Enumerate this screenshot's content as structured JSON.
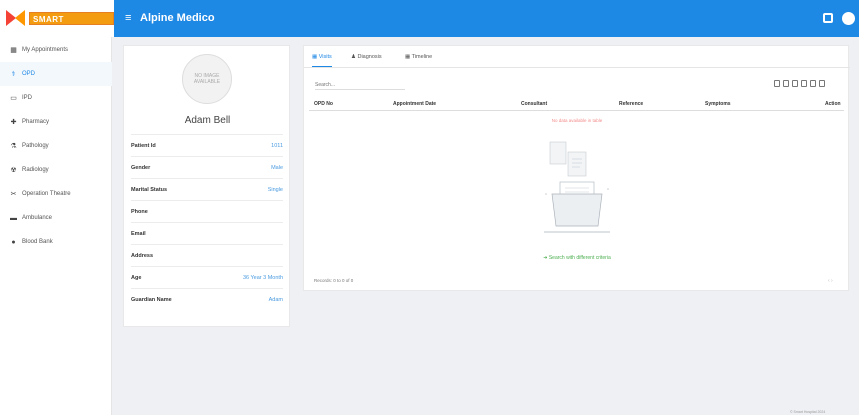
{
  "header": {
    "logo_text": "SMART HOSPITAL",
    "hospital_name": "Alpine Medico",
    "accent": "#1e88e5"
  },
  "sidebar": {
    "items": [
      {
        "label": "My Appointments",
        "icon": "building-icon",
        "glyph": "▦"
      },
      {
        "label": "OPD",
        "icon": "stethoscope-icon",
        "glyph": "⚕"
      },
      {
        "label": "IPD",
        "icon": "bed-icon",
        "glyph": "▭"
      },
      {
        "label": "Pharmacy",
        "icon": "mortar-icon",
        "glyph": "✚"
      },
      {
        "label": "Pathology",
        "icon": "flask-icon",
        "glyph": "⚗"
      },
      {
        "label": "Radiology",
        "icon": "microscope-icon",
        "glyph": "☢"
      },
      {
        "label": "Operation Theatre",
        "icon": "scissors-icon",
        "glyph": "✂"
      },
      {
        "label": "Ambulance",
        "icon": "ambulance-icon",
        "glyph": "🚑"
      },
      {
        "label": "Blood Bank",
        "icon": "blood-drop-icon",
        "glyph": "●"
      }
    ],
    "active_index": 1
  },
  "profile": {
    "avatar_label": "NO IMAGE AVAILABLE",
    "name": "Adam Bell",
    "fields": [
      {
        "label": "Patient Id",
        "value": "1011"
      },
      {
        "label": "Gender",
        "value": "Male"
      },
      {
        "label": "Marital Status",
        "value": "Single"
      },
      {
        "label": "Phone",
        "value": ""
      },
      {
        "label": "Email",
        "value": ""
      },
      {
        "label": "Address",
        "value": ""
      },
      {
        "label": "Age",
        "value": "36 Year 3 Month"
      },
      {
        "label": "Guardian Name",
        "value": "Adam"
      }
    ]
  },
  "panel": {
    "tabs": [
      {
        "label": "Visits",
        "icon": "calendar-icon"
      },
      {
        "label": "Diagnosis",
        "icon": "user-icon"
      },
      {
        "label": "Timeline",
        "icon": "calendar-icon"
      }
    ],
    "active_tab": 0,
    "search_placeholder": "Search...",
    "columns": [
      "OPD No",
      "Appointment Date",
      "Consultant",
      "Reference",
      "Symptoms",
      "Action"
    ],
    "empty_note": "No data available in table",
    "search_hint": "Search with different criteria",
    "records_text": "Records: 0 to 0 of 0",
    "pager_text": "‹ ›"
  },
  "footer_text": "© Smart Hospital 2024"
}
